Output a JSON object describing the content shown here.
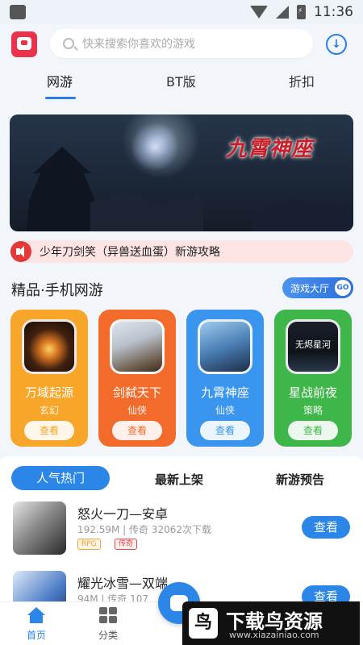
{
  "status_bar": {
    "time": "11:36"
  },
  "header": {
    "search_placeholder": "快来搜索你喜欢的游戏"
  },
  "tabs": [
    {
      "label": "网游",
      "active": true
    },
    {
      "label": "BT版",
      "active": false
    },
    {
      "label": "折扣",
      "active": false
    }
  ],
  "banner": {
    "title": "九霄神座"
  },
  "notice": {
    "text": "少年刀剑笑（异兽送血蛋）新游攻略"
  },
  "section": {
    "title": "精品·手机网游",
    "hall_label": "游戏大厅",
    "hall_go": "GO"
  },
  "cards": [
    {
      "name": "万域起源",
      "genre": "玄幻",
      "button": "查看",
      "color": "#f7a629"
    },
    {
      "name": "剑弑天下",
      "genre": "仙侠",
      "button": "查看",
      "color": "#f26b2b"
    },
    {
      "name": "九霄神座",
      "genre": "仙侠",
      "button": "查看",
      "color": "#3a95ee"
    },
    {
      "name": "星战前夜",
      "genre": "策略",
      "button": "查看",
      "color": "#3fb649",
      "icon_text": "无烬星河"
    }
  ],
  "list_tabs": [
    {
      "label": "人气热门",
      "active": true
    },
    {
      "label": "最新上架",
      "active": false
    },
    {
      "label": "新游预告",
      "active": false
    }
  ],
  "list": [
    {
      "title": "怒火一刀—安卓",
      "meta": "192.59M | 传奇   32062次下载",
      "tags": [
        "RPG",
        "传奇"
      ],
      "button": "查看"
    },
    {
      "title": "耀光冰雪—双端",
      "meta": "94M | 传奇   107",
      "tags": [],
      "button": "查看"
    }
  ],
  "bottom_nav": [
    {
      "label": "首页",
      "active": true
    },
    {
      "label": "分类",
      "active": false
    }
  ],
  "watermark": {
    "title": "下载鸟资源",
    "url": "www.xiazainiao.com",
    "logo": "鸟"
  }
}
